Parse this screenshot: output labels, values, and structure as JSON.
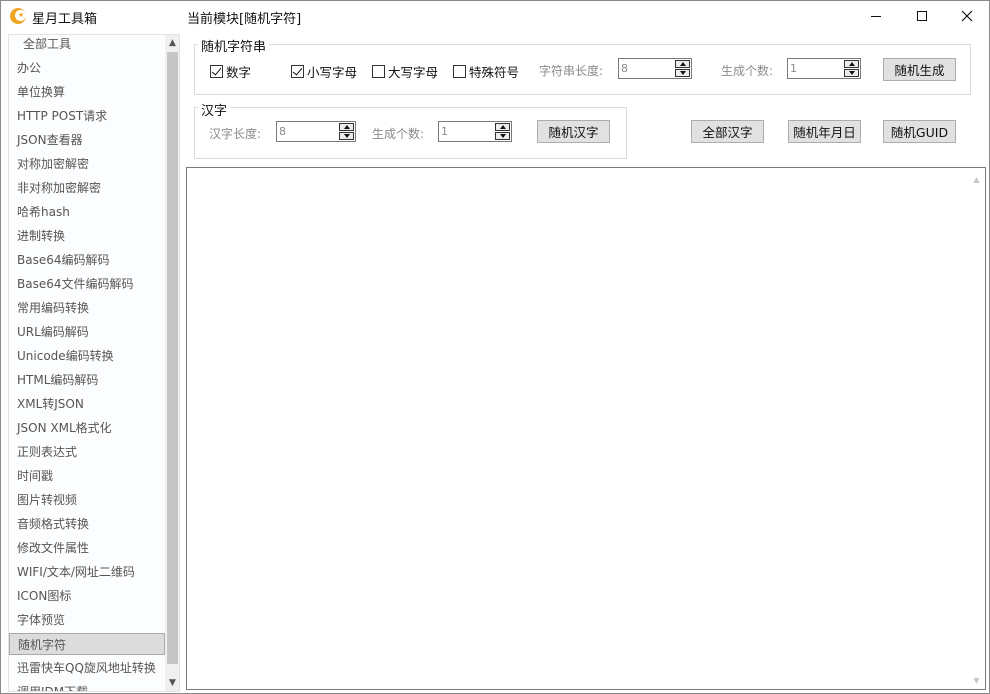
{
  "window": {
    "app_title": "星月工具箱",
    "module_title": "当前模块[随机字符]"
  },
  "sidebar": {
    "items": [
      {
        "label": "全部工具",
        "header": true
      },
      {
        "label": "办公"
      },
      {
        "label": "单位换算"
      },
      {
        "label": "HTTP POST请求"
      },
      {
        "label": "JSON查看器"
      },
      {
        "label": "对称加密解密"
      },
      {
        "label": "非对称加密解密"
      },
      {
        "label": "哈希hash"
      },
      {
        "label": "进制转换"
      },
      {
        "label": "Base64编码解码"
      },
      {
        "label": "Base64文件编码解码"
      },
      {
        "label": "常用编码转换"
      },
      {
        "label": "URL编码解码"
      },
      {
        "label": "Unicode编码转换"
      },
      {
        "label": "HTML编码解码"
      },
      {
        "label": "XML转JSON"
      },
      {
        "label": "JSON XML格式化"
      },
      {
        "label": "正则表达式"
      },
      {
        "label": "时间戳"
      },
      {
        "label": "图片转视频"
      },
      {
        "label": "音频格式转换"
      },
      {
        "label": "修改文件属性"
      },
      {
        "label": "WIFI/文本/网址二维码"
      },
      {
        "label": "ICON图标"
      },
      {
        "label": "字体预览"
      },
      {
        "label": "随机字符",
        "selected": true
      },
      {
        "label": "迅雷快车QQ旋风地址转换"
      },
      {
        "label": "调用IDM下载"
      }
    ],
    "scroll_up": "▲",
    "scroll_down": "▼"
  },
  "random_string": {
    "title": "随机字符串",
    "checkboxes": [
      {
        "label": "数字",
        "checked": true
      },
      {
        "label": "小写字母",
        "checked": true
      },
      {
        "label": "大写字母",
        "checked": false
      },
      {
        "label": "特殊符号",
        "checked": false
      }
    ],
    "length_label": "字符串长度:",
    "length_value": "8",
    "count_label": "生成个数:",
    "count_value": "1",
    "generate_button": "随机生成"
  },
  "hanzi": {
    "title": "汉字",
    "length_label": "汉字长度:",
    "length_value": "8",
    "count_label": "生成个数:",
    "count_value": "1",
    "random_hanzi_button": "随机汉字"
  },
  "extra_buttons": {
    "all_hanzi": "全部汉字",
    "random_date": "随机年月日",
    "random_guid": "随机GUID"
  },
  "output": {
    "value": ""
  }
}
